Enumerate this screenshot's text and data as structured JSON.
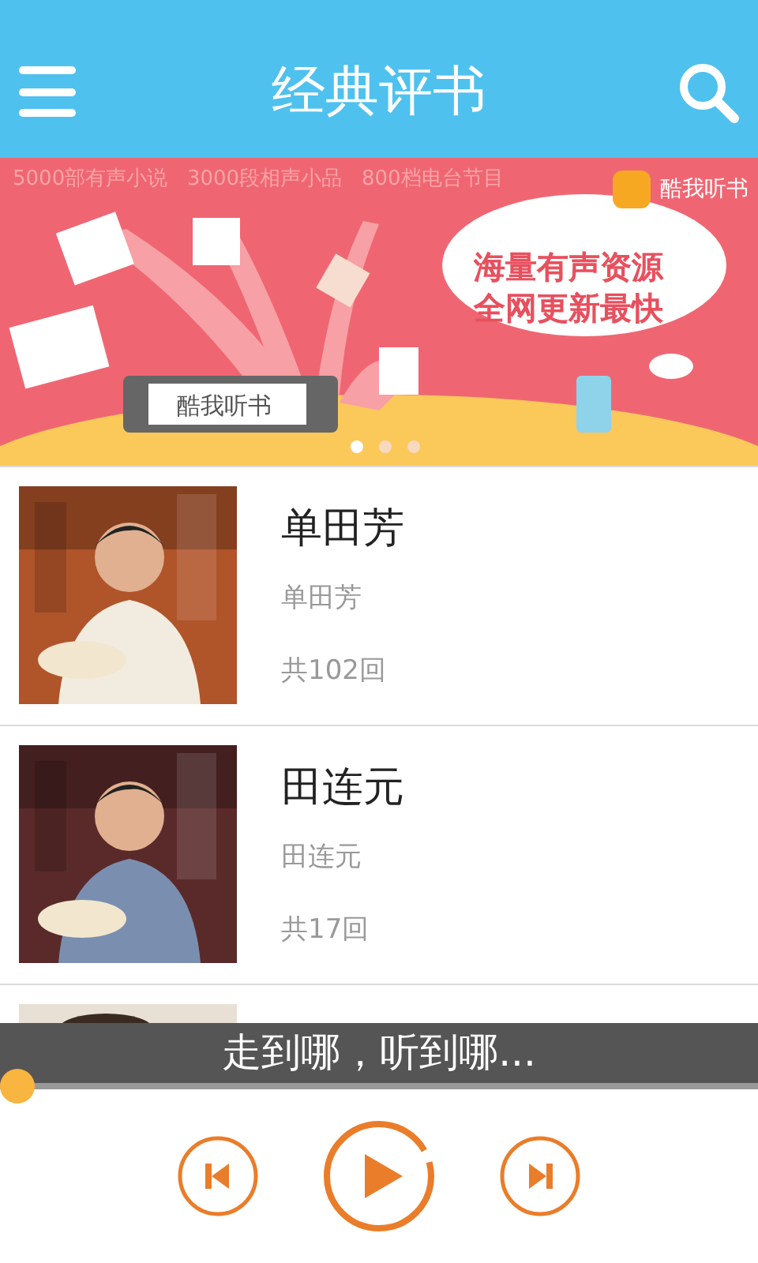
{
  "header": {
    "title": "经典评书"
  },
  "banner": {
    "tagline": "5000部有声小说   3000段相声小品   800档电台节目",
    "brand": "酷我听书",
    "bubble_lines": [
      "海量有声资源",
      "全网更新最快"
    ],
    "tablet_label": "酷我听书",
    "dots": [
      {
        "selected": true
      },
      {
        "selected": false
      },
      {
        "selected": false
      }
    ]
  },
  "items": [
    {
      "title": "单田芳",
      "author": "单田芳",
      "count": "共102回"
    },
    {
      "title": "田连元",
      "author": "田连元",
      "count": "共17回"
    }
  ],
  "player": {
    "caption": "走到哪，听到哪...",
    "progress": {
      "level": 0
    }
  }
}
